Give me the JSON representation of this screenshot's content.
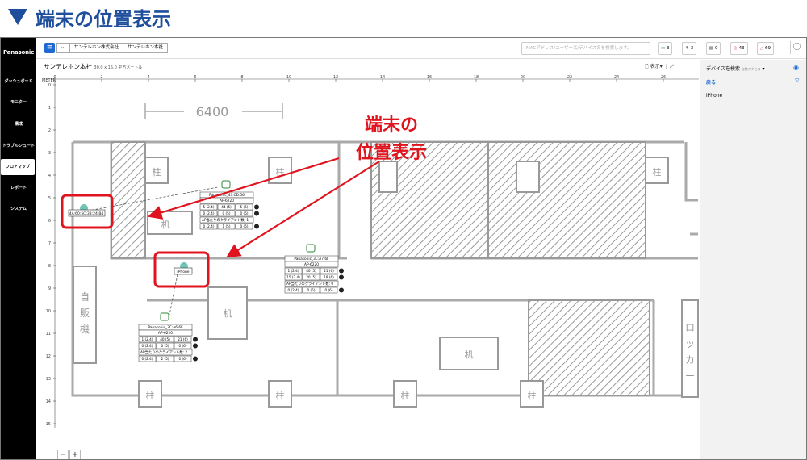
{
  "heading": "端末の位置表示",
  "sidebar": {
    "logo": "Panasonic",
    "items": [
      {
        "label": "ダッシュボード",
        "active": false
      },
      {
        "label": "モニター",
        "active": false
      },
      {
        "label": "構成",
        "active": false
      },
      {
        "label": "トラブルシュート",
        "active": false
      },
      {
        "label": "フロアマップ",
        "active": true
      },
      {
        "label": "レポート",
        "active": false
      },
      {
        "label": "システム",
        "active": false
      }
    ]
  },
  "topbar": {
    "menu_icon": "menu-icon",
    "breadcrumbs": [
      "⋯",
      "サンテレホン株式会社",
      "サンテレホン本社"
    ],
    "search_placeholder": "MACアドレス/ユーザー名/デバイス名を検索します。",
    "stats": [
      {
        "icon": "laptop-icon",
        "value": "3",
        "color": "#2e8b3a"
      },
      {
        "icon": "network-icon",
        "value": "3",
        "color": "#555555"
      },
      {
        "icon": "switch-icon",
        "value": "0",
        "color": "#555555"
      },
      {
        "icon": "shield-icon",
        "value": "43",
        "color": "#d9534f"
      },
      {
        "icon": "warning-icon",
        "value": "69",
        "color": "#d9534f"
      }
    ],
    "info_icon": "ⓘ"
  },
  "map": {
    "title": "サンテレホン本社",
    "dimensions": "30.0 x 15.0 平方メートル",
    "display_label": "表示",
    "unit_label": "METER",
    "x_ticks": [
      "0",
      "2",
      "4",
      "6",
      "8",
      "10",
      "12",
      "14",
      "16",
      "18",
      "20",
      "22",
      "24",
      "26"
    ],
    "y_ticks": [
      "0",
      "1",
      "2",
      "3",
      "4",
      "5",
      "6",
      "7",
      "8",
      "9",
      "10",
      "11",
      "12",
      "13",
      "14",
      "15"
    ],
    "dimension_text": "6400",
    "labels": {
      "pillar": "柱",
      "desk": "机",
      "vending": [
        "自",
        "販",
        "機"
      ],
      "locker": [
        "ロ",
        "ッ",
        "カ",
        "ー"
      ]
    }
  },
  "devices": {
    "mac_client": "4A:60:5C:33:24:B4",
    "iphone": "iPhone",
    "ap_cards": [
      {
        "name": "Panasonic_43:CD:56",
        "model": "AP-6220",
        "rows": [
          [
            "5 (2.4)",
            "44 (5)",
            "5 (6)"
          ],
          [
            "0 (2.4)",
            "0 (5)",
            "0 (6)"
          ],
          [
            "0 (2.4)",
            "1 (5)",
            "0 (6)"
          ]
        ],
        "clients": "AP当たりのクライアント数: 1"
      },
      {
        "name": "Panasonic_3C:A7:6F",
        "model": "AP-6220",
        "rows": [
          [
            "1 (2.4)",
            "40 (5)",
            "21 (6)"
          ],
          [
            "15 (2.4)",
            "20 (5)",
            "18 (6)"
          ],
          [
            "0 (2.4)",
            "0 (5)",
            "0 (6)"
          ]
        ],
        "clients": "AP当たりのクライアント数: 0"
      },
      {
        "name": "Panasonic_3C:A6:6F",
        "model": "AP-6220",
        "rows": [
          [
            "1 (2.4)",
            "40 (5)",
            "21 (6)"
          ],
          [
            "0 (2.4)",
            "0 (5)",
            "0 (6)"
          ],
          [
            "0 (2.4)",
            "2 (5)",
            "0 (6)"
          ]
        ],
        "clients": "AP当たりのクライアント数: 2"
      }
    ]
  },
  "callout": {
    "lines": [
      "端末の",
      "位置表示"
    ],
    "color": "#e0141e"
  },
  "right_panel": {
    "title": "デバイスを検索",
    "subtitle": "自動アクセス",
    "back": "戻る",
    "device": "iPhone"
  },
  "zoom": {
    "minus": "−",
    "plus": "+"
  }
}
